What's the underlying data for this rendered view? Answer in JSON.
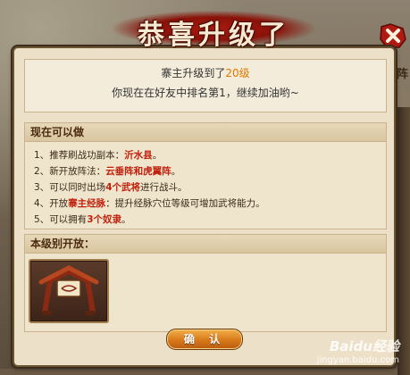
{
  "dialog": {
    "title": "恭喜升级了",
    "message": {
      "line1_prefix": "寨主升级到了",
      "level": "20级",
      "line2": "你现在在好友中排名第1，继续加油哟~"
    },
    "unlocks_section": {
      "heading": "现在可以做",
      "items": [
        {
          "num": "1、",
          "text": "推荐刷战功副本：",
          "highlight": "沂水县",
          "suffix": "。"
        },
        {
          "num": "2、",
          "text": "新开放阵法：",
          "highlight": "云垂阵和虎翼阵",
          "suffix": "。"
        },
        {
          "num": "3、",
          "text": "可以同时出场",
          "highlight": "4个武将",
          "suffix": "进行战斗。"
        },
        {
          "num": "4、",
          "text": "开放",
          "highlight": "寨主经脉",
          "suffix": "：提升经脉穴位等级可增加武将能力。"
        },
        {
          "num": "5、",
          "text": "可以拥有",
          "highlight": "3个奴隶",
          "suffix": "。"
        }
      ]
    },
    "rewards_section": {
      "heading": "本级别开放："
    },
    "confirm_button": "确 认"
  },
  "side_panel_label": "阵",
  "watermark": {
    "brand": "Baidu经验",
    "url": "jingyan.baidu.com"
  },
  "colors": {
    "highlight_orange": "#e07800",
    "highlight_red": "#c0200c",
    "title_banner_red": "#8a1209",
    "button_orange": "#d7781a"
  }
}
